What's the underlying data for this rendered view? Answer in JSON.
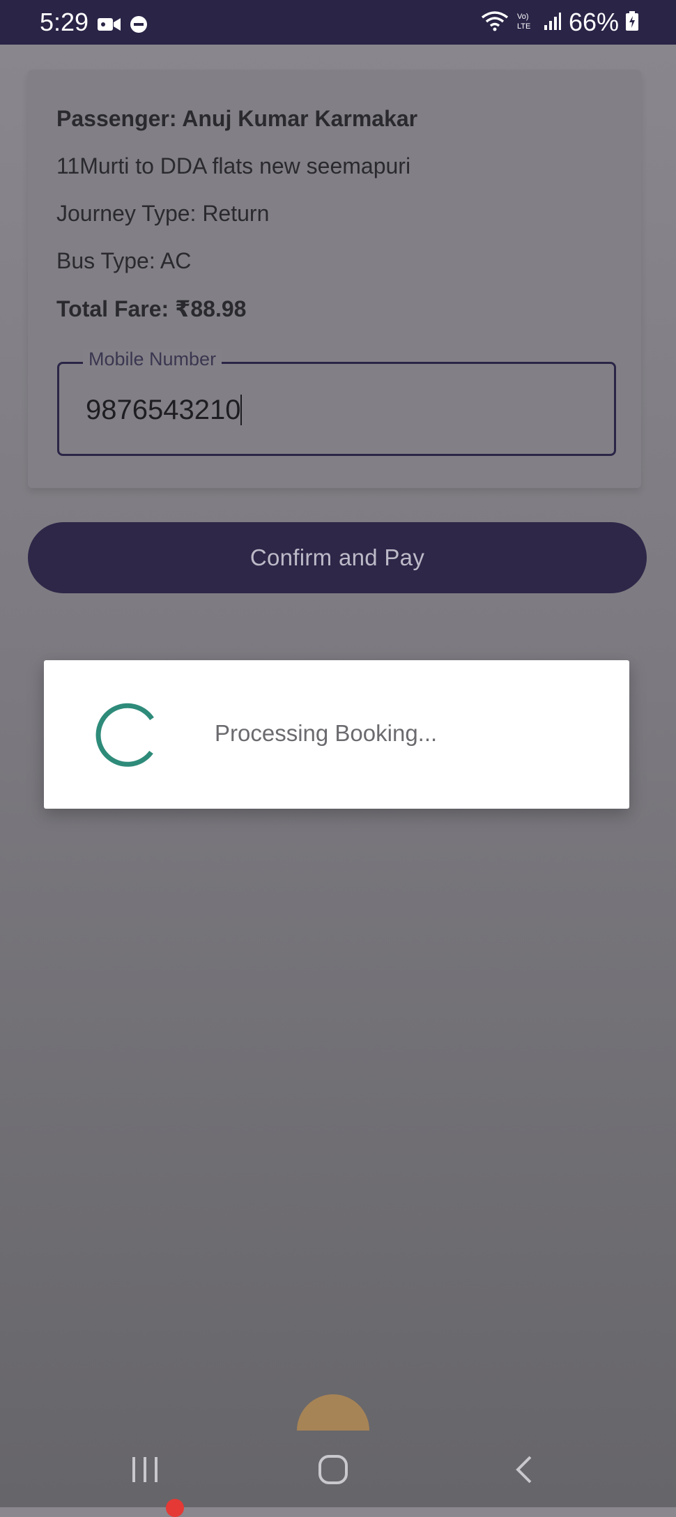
{
  "status_bar": {
    "time": "5:29",
    "battery_percent": "66%",
    "icons": [
      "video-recording-icon",
      "do-not-disturb-icon",
      "wifi-icon",
      "volte-icon",
      "signal-icon",
      "battery-charging-icon"
    ]
  },
  "booking": {
    "passenger": "Passenger: Anuj Kumar Karmakar",
    "route": "11Murti to  DDA flats new seemapuri",
    "journey_type": "Journey Type: Return",
    "bus_type": "Bus Type: AC",
    "total_fare": "Total Fare: ₹88.98"
  },
  "mobile_field": {
    "label": "Mobile Number",
    "value": "9876543210"
  },
  "confirm_button": {
    "label": "Confirm and Pay"
  },
  "dialog": {
    "message": "Processing Booking..."
  },
  "colors": {
    "primary": "#2e2748",
    "spinner": "#2e8b7a",
    "overlay": "#7f7d83"
  },
  "nav_bar": {
    "icons": [
      "recent-apps-icon",
      "home-icon",
      "back-icon"
    ]
  }
}
